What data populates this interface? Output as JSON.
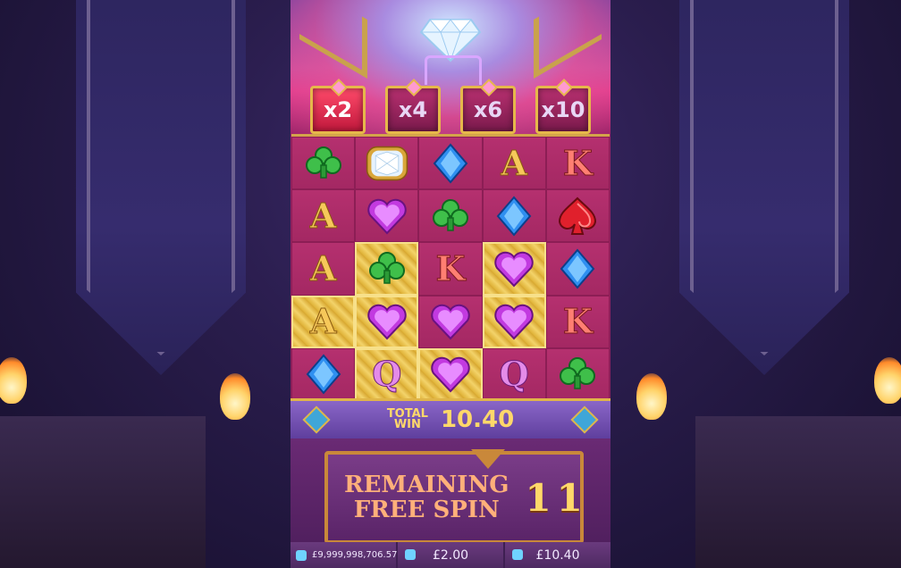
{
  "multipliers": [
    {
      "label": "x2",
      "active": true
    },
    {
      "label": "x4",
      "active": false
    },
    {
      "label": "x6",
      "active": false
    },
    {
      "label": "x10",
      "active": false
    }
  ],
  "grid": [
    [
      {
        "symbol": "club",
        "gold": false
      },
      {
        "symbol": "diamond-gem",
        "gold": false
      },
      {
        "symbol": "blue-diamond",
        "gold": false
      },
      {
        "symbol": "A",
        "gold": false
      },
      {
        "symbol": "K",
        "gold": false
      }
    ],
    [
      {
        "symbol": "A",
        "gold": false
      },
      {
        "symbol": "heart",
        "gold": false
      },
      {
        "symbol": "club",
        "gold": false
      },
      {
        "symbol": "blue-diamond",
        "gold": false
      },
      {
        "symbol": "spade",
        "gold": false
      }
    ],
    [
      {
        "symbol": "A",
        "gold": false
      },
      {
        "symbol": "club",
        "gold": true
      },
      {
        "symbol": "K",
        "gold": false
      },
      {
        "symbol": "heart",
        "gold": true
      },
      {
        "symbol": "blue-diamond",
        "gold": false
      }
    ],
    [
      {
        "symbol": "A",
        "gold": true
      },
      {
        "symbol": "heart",
        "gold": true
      },
      {
        "symbol": "heart",
        "gold": false
      },
      {
        "symbol": "heart",
        "gold": true
      },
      {
        "symbol": "K",
        "gold": false
      }
    ],
    [
      {
        "symbol": "blue-diamond",
        "gold": false
      },
      {
        "symbol": "Q",
        "gold": true
      },
      {
        "symbol": "heart",
        "gold": true
      },
      {
        "symbol": "Q",
        "gold": false
      },
      {
        "symbol": "club",
        "gold": false
      }
    ]
  ],
  "total_win": {
    "label_line1": "TOTAL",
    "label_line2": "WIN",
    "value": "10.40"
  },
  "remaining": {
    "label_line1": "REMAINING",
    "label_line2": "FREE SPIN",
    "value": "11"
  },
  "footer": {
    "balance": "£9,999,998,706.57",
    "bet": "£2.00",
    "win": "£10.40"
  },
  "colors": {
    "gold": "#e0b549",
    "magenta": "#b02a6c",
    "accent_red": "#ff4a6a"
  }
}
